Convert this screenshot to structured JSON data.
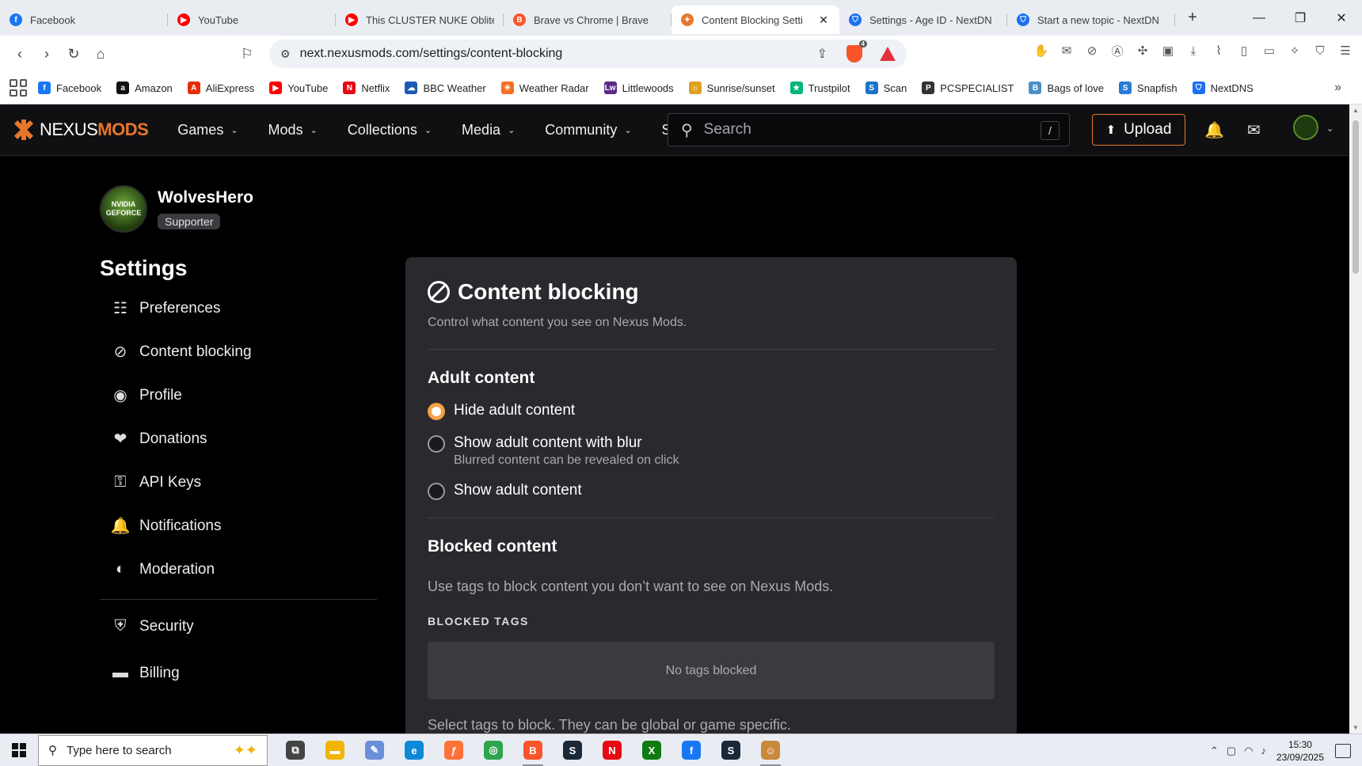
{
  "browser": {
    "tabs": [
      {
        "title": "Facebook",
        "favicon": "facebook-icon",
        "color": "#1877f2",
        "glyph": "f"
      },
      {
        "title": "YouTube",
        "favicon": "youtube-icon",
        "color": "#ff0000",
        "glyph": "▶"
      },
      {
        "title": "This CLUSTER NUKE Obliter",
        "favicon": "youtube-icon",
        "color": "#ff0000",
        "glyph": "▶"
      },
      {
        "title": "Brave vs Chrome | Brave",
        "favicon": "brave-icon",
        "color": "#fb542b",
        "glyph": "B"
      },
      {
        "title": "Content Blocking Setti",
        "favicon": "nexusmods-icon",
        "color": "#e8762b",
        "glyph": "✦",
        "active": true
      },
      {
        "title": "Settings - Age ID - NextDN",
        "favicon": "nextdns-icon",
        "color": "#1d6ff2",
        "glyph": "⛉"
      },
      {
        "title": "Start a new topic - NextDN",
        "favicon": "nextdns-icon",
        "color": "#1d6ff2",
        "glyph": "⛉"
      }
    ],
    "url": "next.nexusmods.com/settings/content-blocking",
    "bookmarks": [
      {
        "label": "Facebook",
        "color": "#1877f2",
        "glyph": "f"
      },
      {
        "label": "Amazon",
        "color": "#111",
        "glyph": "a"
      },
      {
        "label": "AliExpress",
        "color": "#e62e04",
        "glyph": "A"
      },
      {
        "label": "YouTube",
        "color": "#ff0000",
        "glyph": "▶"
      },
      {
        "label": "Netflix",
        "color": "#e50914",
        "glyph": "N"
      },
      {
        "label": "BBC Weather",
        "color": "#1d5ab3",
        "glyph": "☁"
      },
      {
        "label": "Weather Radar",
        "color": "#f37021",
        "glyph": "☀"
      },
      {
        "label": "Littlewoods",
        "color": "#5b2a86",
        "glyph": "Lw"
      },
      {
        "label": "Sunrise/sunset",
        "color": "#e0a020",
        "glyph": "☼"
      },
      {
        "label": "Trustpilot",
        "color": "#00b67a",
        "glyph": "★"
      },
      {
        "label": "Scan",
        "color": "#1a73c7",
        "glyph": "S"
      },
      {
        "label": "PCSPECIALIST",
        "color": "#333",
        "glyph": "P"
      },
      {
        "label": "Bags of love",
        "color": "#4a90c8",
        "glyph": "B"
      },
      {
        "label": "Snapfish",
        "color": "#2a7bd6",
        "glyph": "S"
      },
      {
        "label": "NextDNS",
        "color": "#1d6ff2",
        "glyph": "⛉"
      }
    ]
  },
  "header": {
    "logo_prefix": "NEXUS",
    "logo_suffix": "MODS",
    "nav": [
      "Games",
      "Mods",
      "Collections",
      "Media",
      "Community",
      "Support"
    ],
    "search_placeholder": "Search",
    "search_shortcut": "/",
    "upload_label": "Upload"
  },
  "user": {
    "avatar_text": "NVIDIA GEFORCE",
    "name": "WolvesHero",
    "badge": "Supporter"
  },
  "sidebar": {
    "title": "Settings",
    "items": [
      {
        "label": "Preferences",
        "icon": "sliders-icon",
        "glyph": "☷"
      },
      {
        "label": "Content blocking",
        "icon": "block-icon",
        "glyph": "⊘"
      },
      {
        "label": "Profile",
        "icon": "user-circle-icon",
        "glyph": "◉"
      },
      {
        "label": "Donations",
        "icon": "donation-hand-icon",
        "glyph": "❤"
      },
      {
        "label": "API Keys",
        "icon": "key-icon",
        "glyph": "⚿"
      },
      {
        "label": "Notifications",
        "icon": "bell-icon",
        "glyph": "🔔"
      },
      {
        "label": "Moderation",
        "icon": "shield-half-icon",
        "glyph": "◐"
      },
      {
        "label": "Security",
        "icon": "shield-icon",
        "glyph": "⛨"
      },
      {
        "label": "Billing",
        "icon": "credit-card-icon",
        "glyph": "▬"
      }
    ]
  },
  "content": {
    "title": "Content blocking",
    "subtitle": "Control what content you see on Nexus Mods.",
    "adult": {
      "heading": "Adult content",
      "options": [
        {
          "label": "Hide adult content",
          "hint": "",
          "selected": true
        },
        {
          "label": "Show adult content with blur",
          "hint": "Blurred content can be revealed on click",
          "selected": false
        },
        {
          "label": "Show adult content",
          "hint": "",
          "selected": false
        }
      ]
    },
    "blocked": {
      "heading": "Blocked content",
      "description": "Use tags to block content you don’t want to see on Nexus Mods.",
      "tags_label": "BLOCKED TAGS",
      "empty_text": "No tags blocked",
      "select_hint": "Select tags to block. They can be global or game specific."
    }
  },
  "taskbar": {
    "search_placeholder": "Type here to search",
    "apps": [
      {
        "name": "task-view-icon",
        "color": "#444",
        "glyph": "⧉",
        "run": false
      },
      {
        "name": "file-explorer-icon",
        "color": "#f2b400",
        "glyph": "▬",
        "run": false
      },
      {
        "name": "photos-app-icon",
        "color": "#6a8fd8",
        "glyph": "✎",
        "run": false
      },
      {
        "name": "edge-icon",
        "color": "#0c8ad8",
        "glyph": "e",
        "run": false
      },
      {
        "name": "firefox-icon",
        "color": "#ff7139",
        "glyph": "ƒ",
        "run": false
      },
      {
        "name": "chrome-icon",
        "color": "#2ea44f",
        "glyph": "◎",
        "run": false
      },
      {
        "name": "brave-icon",
        "color": "#fb542b",
        "glyph": "B",
        "run": true
      },
      {
        "name": "steam-icon",
        "color": "#1b2838",
        "glyph": "S",
        "run": false
      },
      {
        "name": "netflix-icon",
        "color": "#e50914",
        "glyph": "N",
        "run": false
      },
      {
        "name": "xbox-icon",
        "color": "#107c10",
        "glyph": "X",
        "run": false
      },
      {
        "name": "facebook-icon",
        "color": "#1877f2",
        "glyph": "f",
        "run": false
      },
      {
        "name": "steam-icon",
        "color": "#1b2838",
        "glyph": "S",
        "run": false
      },
      {
        "name": "game-app-icon",
        "color": "#c98a3c",
        "glyph": "☺",
        "run": true
      }
    ],
    "time": "15:30",
    "date": "23/09/2025"
  },
  "colors": {
    "accent": "#e8762b",
    "card_bg": "#29292e",
    "page_bg": "#000000"
  }
}
